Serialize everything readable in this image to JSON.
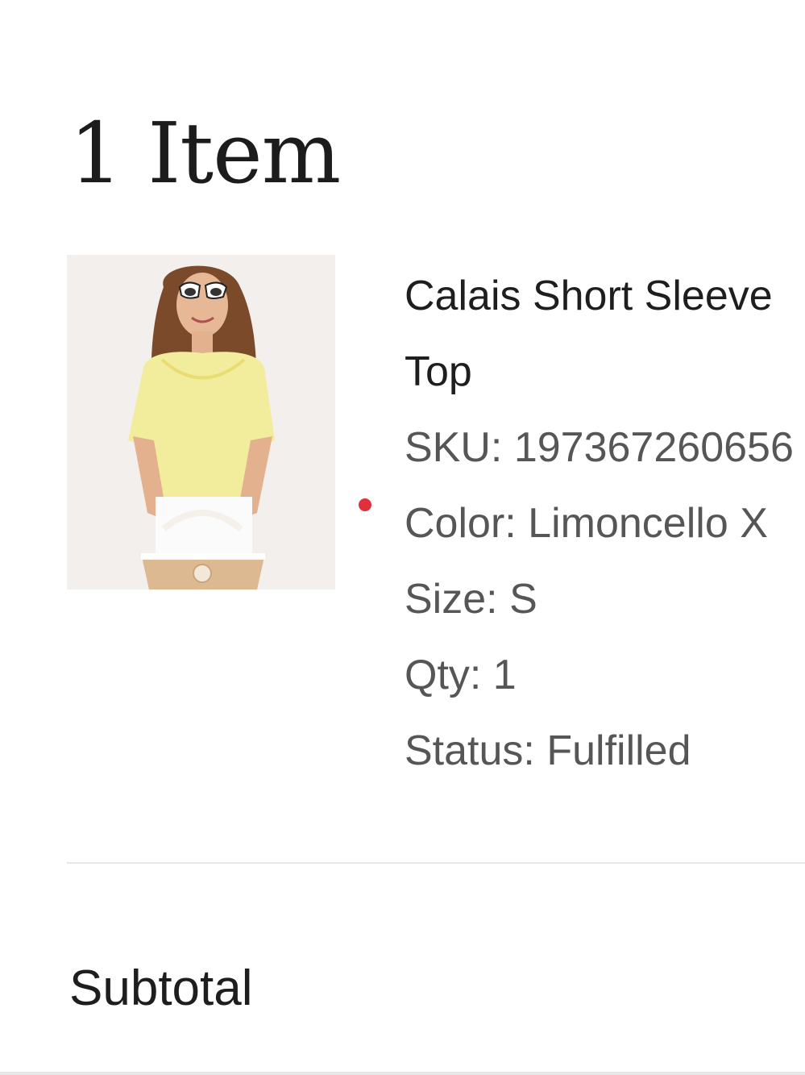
{
  "header": {
    "title": "1 Item"
  },
  "item": {
    "image_alt": "Calais Short Sleeve Top product photo",
    "name": "Calais Short Sleeve Top",
    "sku_label": "SKU:",
    "sku_value": "197367260656",
    "color_label": "Color:",
    "color_value": "Limoncello X",
    "size_label": "Size:",
    "size_value": "S",
    "qty_label": "Qty:",
    "qty_value": "1",
    "status_label": "Status:",
    "status_value": "Fulfilled",
    "indicator_color": "#e0303b"
  },
  "summary": {
    "subtotal_label": "Subtotal"
  }
}
